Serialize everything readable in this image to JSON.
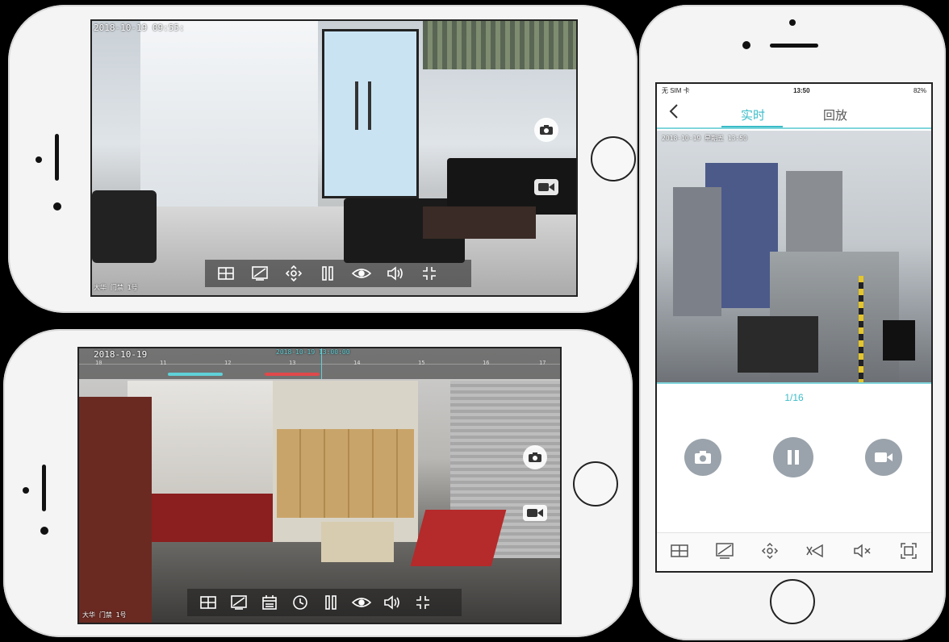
{
  "phone_top_left": {
    "osd_timestamp": "2018-10-19 09:55:",
    "osd_bottom": "大华 门禁 1号",
    "side_icons": [
      "camera-icon",
      "video-record-icon"
    ],
    "toolbar_icons": [
      "grid-layout-icon",
      "image-quality-icon",
      "ptz-control-icon",
      "pause-icon",
      "eye-icon",
      "speaker-icon",
      "exit-fullscreen-icon"
    ]
  },
  "phone_bottom_left": {
    "osd_timestamp": "2018-10-19",
    "timeline_time": "2018-10-19 13:00:00",
    "timeline_labels": [
      "10",
      "11",
      "12",
      "13",
      "14",
      "15",
      "16",
      "17"
    ],
    "osd_bottom": "大华 门禁 1号",
    "side_icons": [
      "camera-icon",
      "video-record-icon"
    ],
    "toolbar_icons": [
      "grid-layout-icon",
      "image-quality-icon",
      "calendar-icon",
      "clock-icon",
      "pause-icon",
      "eye-icon",
      "speaker-icon",
      "exit-fullscreen-icon"
    ]
  },
  "phone_right": {
    "status": {
      "carrier": "无 SIM 卡",
      "time": "13:50",
      "battery": "82%"
    },
    "tabs": {
      "live": "实时",
      "playback": "回放"
    },
    "osd_timestamp": "2018-10-19 星期五 13:50",
    "page_indicator": "1/16",
    "action_buttons": [
      "camera-icon",
      "pause-icon",
      "video-record-icon"
    ],
    "bottom_icons": [
      "grid-layout-icon",
      "image-quality-icon",
      "ptz-control-icon",
      "talk-icon",
      "mute-icon",
      "fullscreen-icon"
    ]
  },
  "colors": {
    "accent": "#3bbcc8",
    "timeline_recorded": "#5fd0d8",
    "timeline_alarm": "#e0484a"
  }
}
